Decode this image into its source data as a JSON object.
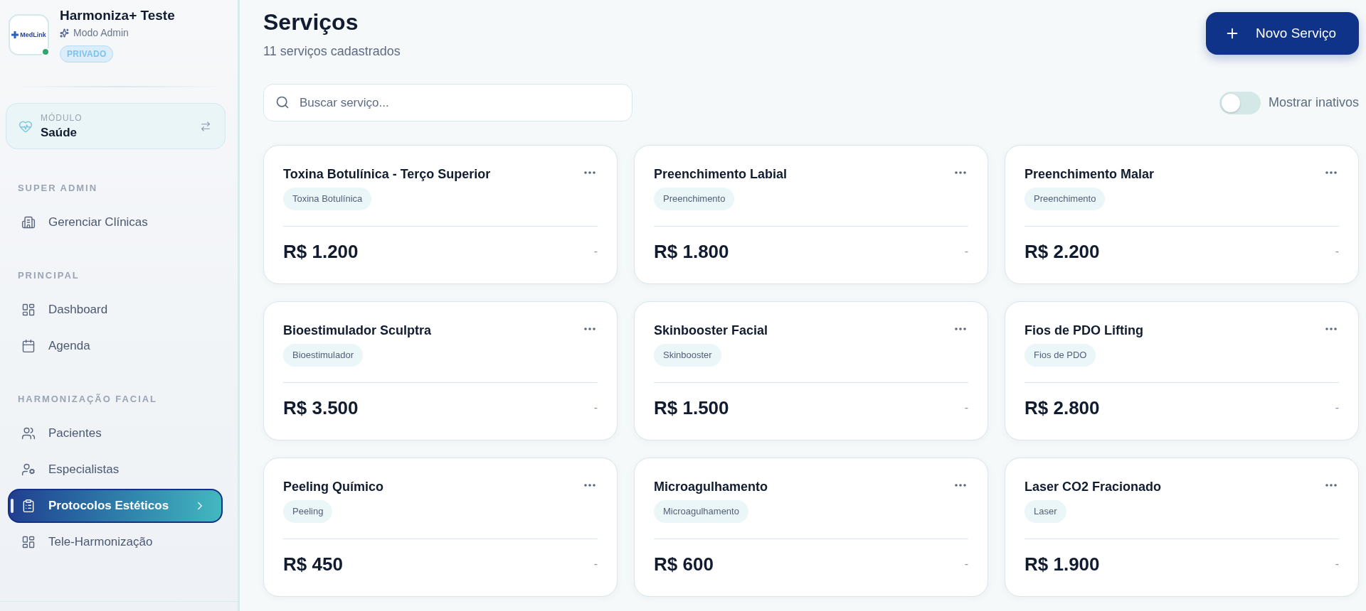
{
  "workspace": {
    "logo_text": "MedLink",
    "name": "Harmoniza+ Teste",
    "role": "Modo Admin",
    "badge": "PRIVADO",
    "online": true
  },
  "module": {
    "label": "MÓDULO",
    "value": "Saúde"
  },
  "sidebar": {
    "sections": [
      {
        "title": "SUPER ADMIN",
        "items": [
          {
            "label": "Gerenciar Clínicas",
            "selected": false
          }
        ]
      },
      {
        "title": "PRINCIPAL",
        "items": [
          {
            "label": "Dashboard",
            "selected": false
          },
          {
            "label": "Agenda",
            "selected": false
          }
        ]
      },
      {
        "title": "HARMONIZAÇÃO FACIAL",
        "items": [
          {
            "label": "Pacientes",
            "selected": false
          },
          {
            "label": "Especialistas",
            "selected": false
          },
          {
            "label": "Protocolos Estéticos",
            "selected": true
          },
          {
            "label": "Tele-Harmonização",
            "selected": false
          }
        ]
      }
    ]
  },
  "header": {
    "title": "Serviços",
    "subtitle": "11 serviços cadastrados",
    "new_button": "Novo Serviço"
  },
  "search": {
    "placeholder": "Buscar serviço..."
  },
  "toggle": {
    "label": "Mostrar inativos",
    "on": false
  },
  "services": [
    {
      "name": "Toxina Botulínica - Terço Superior",
      "category": "Toxina Botulínica",
      "price": "R$ 1.200",
      "aside": "-"
    },
    {
      "name": "Preenchimento Labial",
      "category": "Preenchimento",
      "price": "R$ 1.800",
      "aside": "-"
    },
    {
      "name": "Preenchimento Malar",
      "category": "Preenchimento",
      "price": "R$ 2.200",
      "aside": "-"
    },
    {
      "name": "Bioestimulador Sculptra",
      "category": "Bioestimulador",
      "price": "R$ 3.500",
      "aside": "-"
    },
    {
      "name": "Skinbooster Facial",
      "category": "Skinbooster",
      "price": "R$ 1.500",
      "aside": "-"
    },
    {
      "name": "Fios de PDO Lifting",
      "category": "Fios de PDO",
      "price": "R$ 2.800",
      "aside": "-"
    },
    {
      "name": "Peeling Químico",
      "category": "Peeling",
      "price": "R$ 450",
      "aside": "-"
    },
    {
      "name": "Microagulhamento",
      "category": "Microagulhamento",
      "price": "R$ 600",
      "aside": "-"
    },
    {
      "name": "Laser CO2 Fracionado",
      "category": "Laser",
      "price": "R$ 1.900",
      "aside": "-"
    }
  ]
}
